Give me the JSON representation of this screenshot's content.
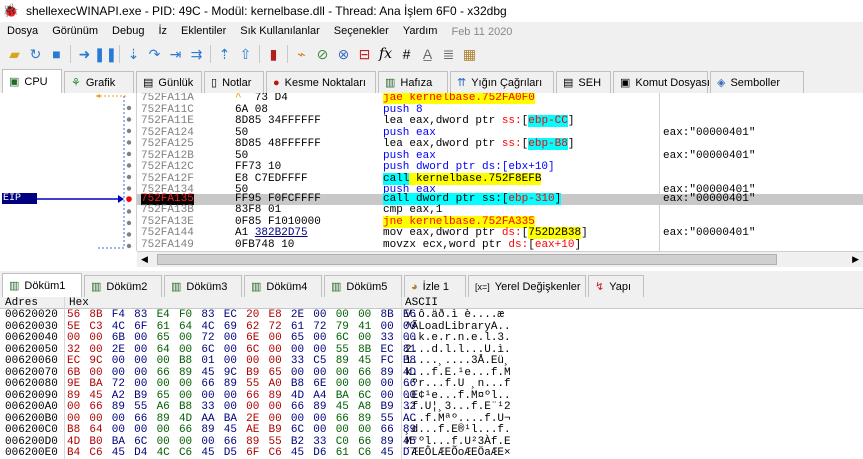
{
  "window": {
    "title": "shellexecWINAPI.exe - PID: 49C - Modül: kernelbase.dll - Thread: Ana İşlem 6F0 - x32dbg"
  },
  "menu": {
    "items": [
      "Dosya",
      "Görünüm",
      "Debug",
      "İz",
      "Eklentiler",
      "Sık Kullanılanlar",
      "Seçenekler",
      "Yardım"
    ],
    "date": "Feb 11 2020"
  },
  "toolbar": {
    "icons": [
      "open-icon",
      "restart-icon",
      "close-icon",
      "run-icon",
      "pause-icon",
      "step-into-icon",
      "step-over-icon",
      "trace-into-icon",
      "trace-over-icon",
      "execute-till-return-icon",
      "run-to-user-code-icon",
      "scylla-icon",
      "patch-icon",
      "comment-icon",
      "label-icon",
      "bookmark-icon",
      "function-icon",
      "sharp-icon",
      "font-a-icon",
      "list-icon",
      "calculator-icon"
    ]
  },
  "tabs": [
    {
      "label": "CPU",
      "icon": "cpu-icon"
    },
    {
      "label": "Grafik",
      "icon": "graph-icon"
    },
    {
      "label": "Günlük",
      "icon": "log-icon"
    },
    {
      "label": "Notlar",
      "icon": "notes-icon"
    },
    {
      "label": "Kesme Noktaları",
      "icon": "breakpoint-icon"
    },
    {
      "label": "Hafıza",
      "icon": "memory-icon"
    },
    {
      "label": "Yığın Çağrıları",
      "icon": "callstack-icon"
    },
    {
      "label": "SEH",
      "icon": "seh-icon"
    },
    {
      "label": "Komut Dosyası",
      "icon": "script-icon"
    },
    {
      "label": "Semboller",
      "icon": "symbols-icon"
    }
  ],
  "cpu": {
    "eip_label": "EIP",
    "rows": [
      {
        "addr": "752FA11A",
        "bytes": "^ 73 D4",
        "dis": "jae kernelbase.752FA0F0",
        "cmt": ""
      },
      {
        "addr": "752FA11C",
        "bytes": "6A 08",
        "dis": "push 8",
        "cmt": ""
      },
      {
        "addr": "752FA11E",
        "bytes": "8D85 34FFFFFF",
        "dis": "lea eax,dword ptr ss:[ebp-CC]",
        "cmt": ""
      },
      {
        "addr": "752FA124",
        "bytes": "50",
        "dis": "push eax",
        "cmt": "eax:\"00000401\""
      },
      {
        "addr": "752FA125",
        "bytes": "8D85 48FFFFFF",
        "dis": "lea eax,dword ptr ss:[ebp-B8]",
        "cmt": ""
      },
      {
        "addr": "752FA12B",
        "bytes": "50",
        "dis": "push eax",
        "cmt": "eax:\"00000401\""
      },
      {
        "addr": "752FA12C",
        "bytes": "FF73 10",
        "dis": "push dword ptr ds:[ebx+10]",
        "cmt": ""
      },
      {
        "addr": "752FA12F",
        "bytes": "E8 C7EDFFFF",
        "dis": "call kernelbase.752F8EFB",
        "cmt": ""
      },
      {
        "addr": "752FA134",
        "bytes": "50",
        "dis": "push eax",
        "cmt": "eax:\"00000401\""
      },
      {
        "addr": "752FA135",
        "bytes": "FF95 F0FCFFFF",
        "dis": "call dword ptr ss:[ebp-310]",
        "cmt": "eax:\"00000401\""
      },
      {
        "addr": "752FA13B",
        "bytes": "83F8 01",
        "dis": "cmp eax,1",
        "cmt": ""
      },
      {
        "addr": "752FA13E",
        "bytes": "0F85 F1010000",
        "dis": "jne kernelbase.752FA335",
        "cmt": ""
      },
      {
        "addr": "752FA144",
        "bytes": "A1 382B2D75",
        "dis": "mov eax,dword ptr ds:[752D2B38]",
        "cmt": "eax:\"00000401\""
      },
      {
        "addr": "752FA149",
        "bytes": "0FB748 10",
        "dis": "movzx ecx,word ptr ds:[eax+10]",
        "cmt": ""
      }
    ]
  },
  "dump_tabs": [
    {
      "label": "Döküm1",
      "icon": "dump-icon"
    },
    {
      "label": "Döküm2",
      "icon": "dump-icon"
    },
    {
      "label": "Döküm3",
      "icon": "dump-icon"
    },
    {
      "label": "Döküm4",
      "icon": "dump-icon"
    },
    {
      "label": "Döküm5",
      "icon": "dump-icon"
    },
    {
      "label": "İzle 1",
      "icon": "watch-icon"
    },
    {
      "label": "Yerel Değişkenler",
      "icon": "locals-icon"
    },
    {
      "label": "Yapı",
      "icon": "struct-icon"
    }
  ],
  "dump": {
    "headers": {
      "addr": "Adres",
      "hex": "Hex",
      "ascii": "ASCII"
    },
    "rows": [
      {
        "addr": "00620020",
        "hex": "56 8B F4 83 E4 F0 83 EC 20 E8 2E 00 00 00 8B E6",
        "ascii": "V.ô.äð.ì è....æ"
      },
      {
        "addr": "00620030",
        "hex": "5E C3 4C 6F 61 64 4C 69 62 72 61 72 79 41 00 00",
        "ascii": "^ÃLoadLibraryA.."
      },
      {
        "addr": "00620040",
        "hex": "00 00 6B 00 65 00 72 00 6E 00 65 00 6C 00 33 00",
        "ascii": "..k.e.r.n.e.l.3."
      },
      {
        "addr": "00620050",
        "hex": "32 00 2E 00 64 00 6C 00 6C 00 00 00 55 8B EC 81",
        "ascii": "2...d.l.l...U.ì."
      },
      {
        "addr": "00620060",
        "hex": "EC 9C 00 00 00 B8 01 00 00 00 33 C5 89 45 FC B8",
        "ascii": "ì....¸....3Å.Eü¸"
      },
      {
        "addr": "00620070",
        "hex": "6B 00 00 00 66 89 45 9C B9 65 00 00 00 66 89 4D",
        "ascii": "k...f.E.¹e...f.M"
      },
      {
        "addr": "00620080",
        "hex": "9E BA 72 00 00 00 66 89 55 A0 B8 6E 00 00 00 66",
        "ascii": ".ºr...f.U ¸n...f"
      },
      {
        "addr": "00620090",
        "hex": "89 45 A2 B9 65 00 00 00 66 89 4D A4 BA 6C 00 00",
        "ascii": ".E¢¹e...f.M¤ºl.."
      },
      {
        "addr": "006200A0",
        "hex": "00 66 89 55 A6 B8 33 00 00 00 66 89 45 A8 B9 32",
        "ascii": ".f.U¦¸3...f.E¨¹2"
      },
      {
        "addr": "006200B0",
        "hex": "00 00 00 66 89 4D AA BA 2E 00 00 00 66 89 55 AC",
        "ascii": "...f.Mªº....f.U¬"
      },
      {
        "addr": "006200C0",
        "hex": "B8 64 00 00 00 66 89 45 AE B9 6C 00 00 00 66 89",
        "ascii": "¸d...f.E®¹l...f."
      },
      {
        "addr": "006200D0",
        "hex": "4D B0 BA 6C 00 00 00 66 89 55 B2 33 C0 66 89 45",
        "ascii": "M°ºl...f.U²3Àf.E"
      },
      {
        "addr": "006200E0",
        "hex": "B4 C6 45 D4 4C C6 45 D5 6F C6 45 D6 61 C6 45 D7",
        "ascii": "´ÆEÔLÆEÕoÆEÖaÆE×"
      }
    ]
  }
}
